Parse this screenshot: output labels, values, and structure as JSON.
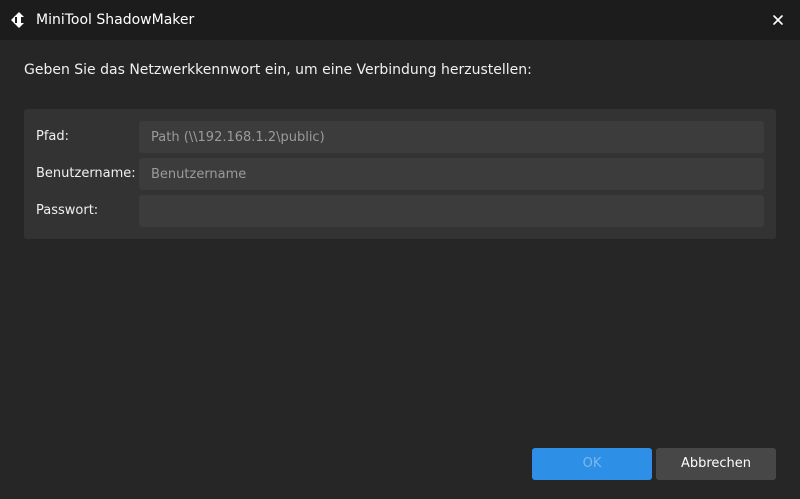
{
  "window": {
    "title": "MiniTool ShadowMaker",
    "icon": "minitool-logo-icon",
    "close_icon": "close-icon"
  },
  "dialog": {
    "instruction": "Geben Sie das Netzwerkkennwort ein, um eine Verbindung herzustellen:"
  },
  "form": {
    "path": {
      "label": "Pfad:",
      "placeholder": "Path (\\\\192.168.1.2\\public)",
      "value": ""
    },
    "username": {
      "label": "Benutzername:",
      "placeholder": "Benutzername",
      "value": ""
    },
    "password": {
      "label": "Passwort:",
      "placeholder": "",
      "value": ""
    }
  },
  "buttons": {
    "ok_label": "OK",
    "ok_enabled": false,
    "cancel_label": "Abbrechen"
  },
  "colors": {
    "titlebar": "#1c1c1c",
    "background": "#262626",
    "panel": "#333333",
    "input": "#3c3c3c",
    "accent": "#2d8fe6",
    "cancel_button": "#474747"
  }
}
